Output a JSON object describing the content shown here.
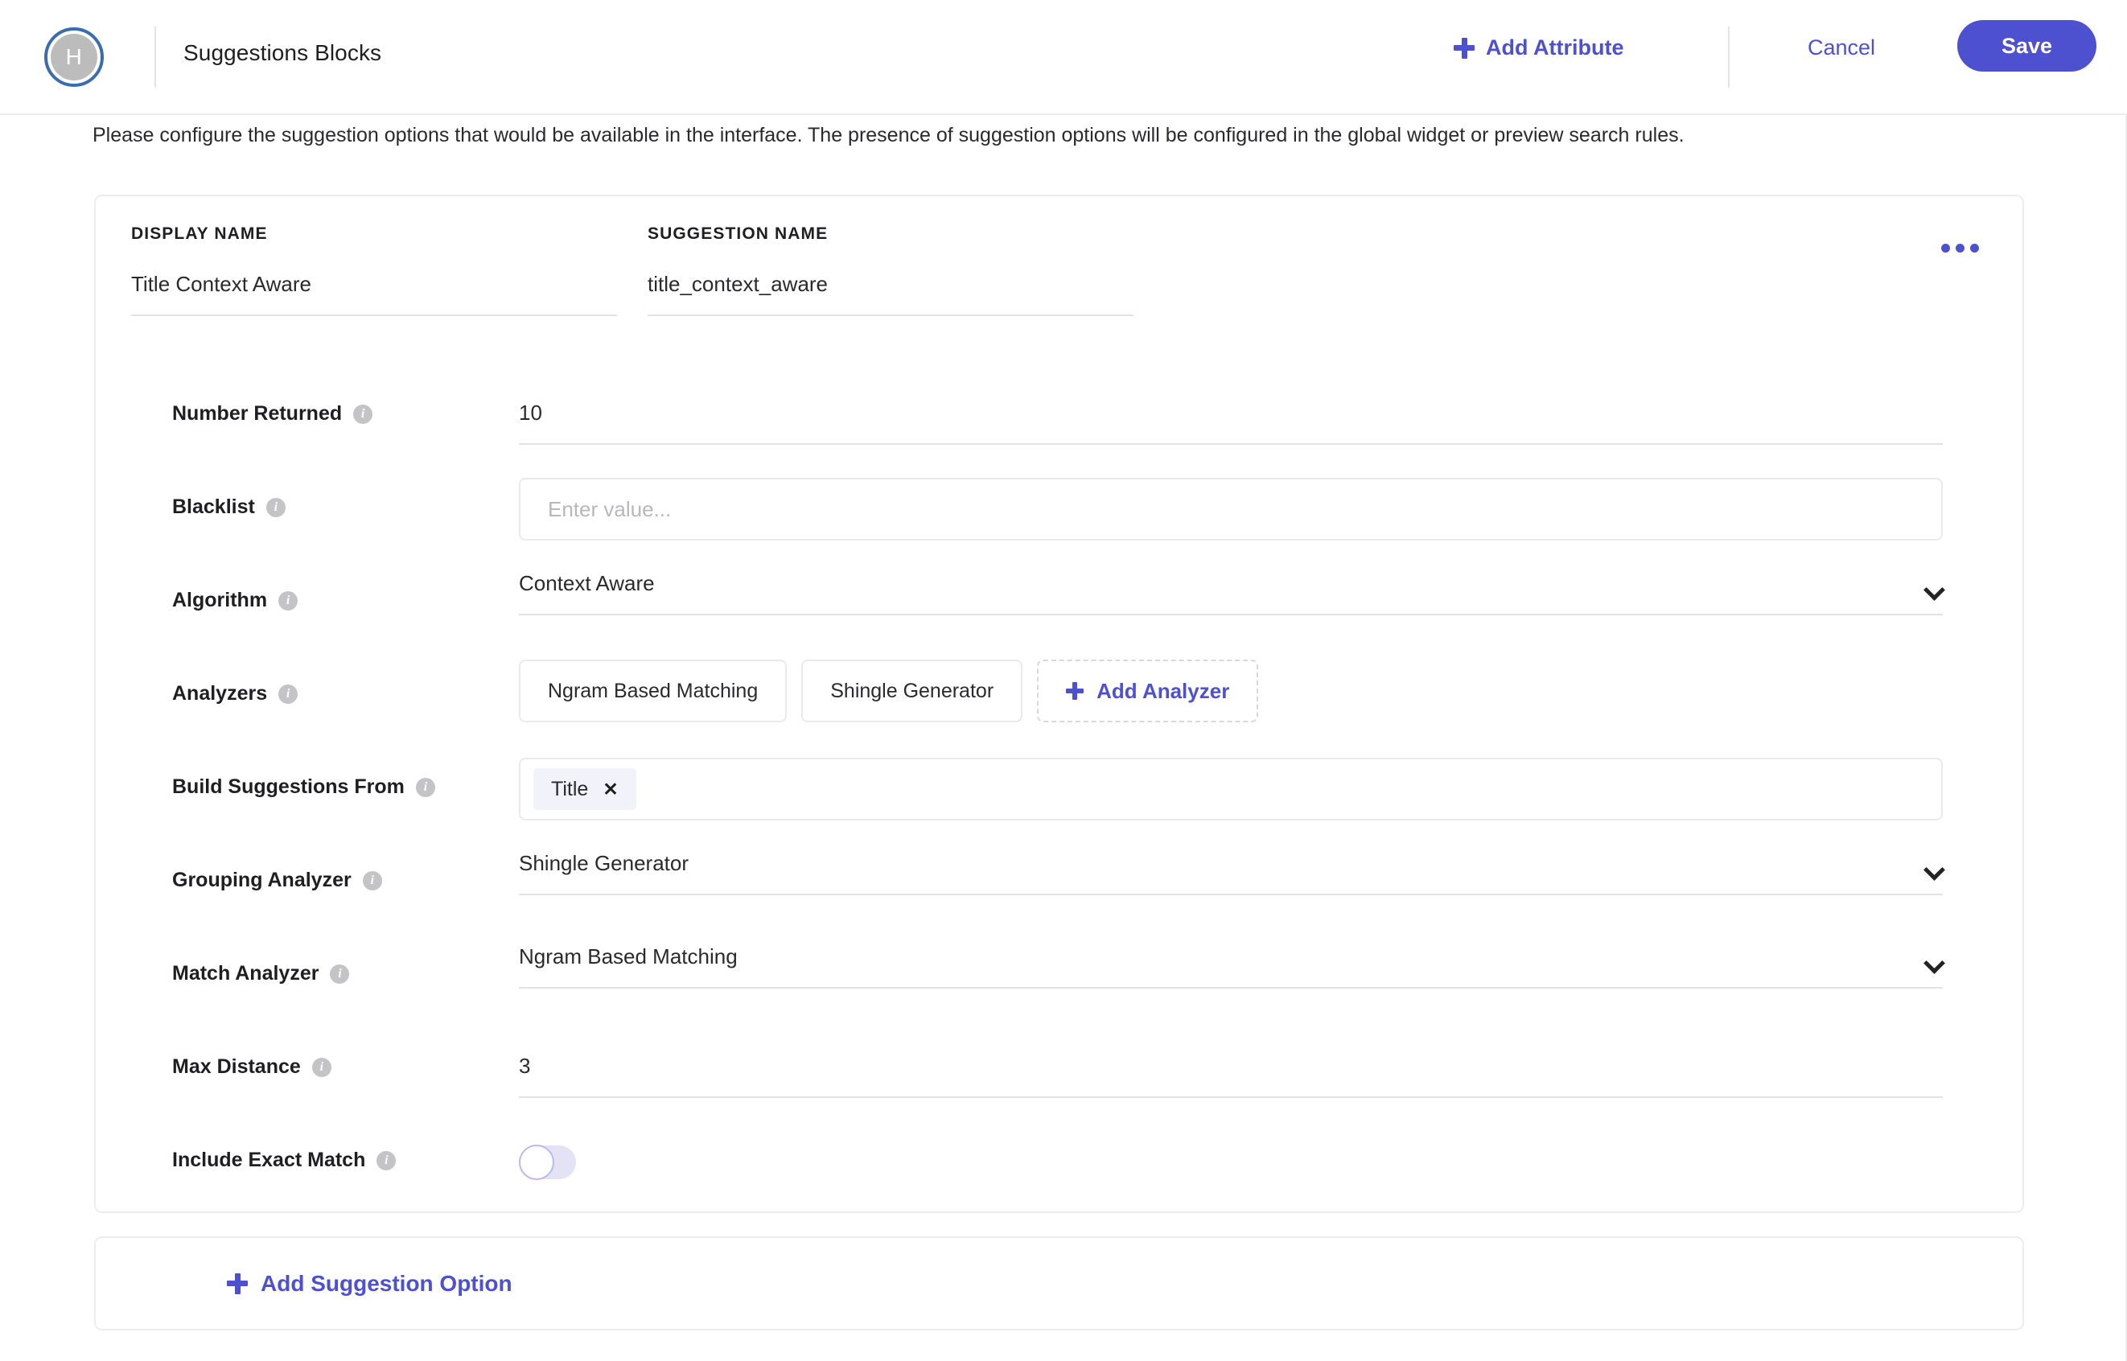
{
  "header": {
    "avatar_initial": "H",
    "title": "Suggestions Blocks",
    "add_attribute_label": "Add Attribute",
    "cancel_label": "Cancel",
    "save_label": "Save",
    "accent_color": "#4e51cf",
    "avatar_ring_color": "#3a6cb2"
  },
  "description": "Please configure the suggestion options that would be available in the interface. The presence of suggestion options will be configured in the global widget or preview search rules.",
  "card": {
    "display_name": {
      "label": "DISPLAY NAME",
      "value": "Title Context Aware"
    },
    "suggestion_name": {
      "label": "SUGGESTION NAME",
      "value": "title_context_aware"
    },
    "menu_icon": "ellipsis-icon",
    "fields": {
      "number_returned": {
        "label": "Number Returned",
        "value": "10"
      },
      "blacklist": {
        "label": "Blacklist",
        "value": "",
        "placeholder": "Enter value..."
      },
      "algorithm": {
        "label": "Algorithm",
        "value": "Context Aware"
      },
      "analyzers": {
        "label": "Analyzers",
        "chips": [
          "Ngram Based Matching",
          "Shingle Generator"
        ],
        "add_label": "Add Analyzer"
      },
      "build_suggestions_from": {
        "label": "Build Suggestions From",
        "tokens": [
          "Title"
        ],
        "remove_glyph": "✕"
      },
      "grouping_analyzer": {
        "label": "Grouping Analyzer",
        "value": "Shingle Generator"
      },
      "match_analyzer": {
        "label": "Match Analyzer",
        "value": "Ngram Based Matching"
      },
      "max_distance": {
        "label": "Max Distance",
        "value": "3"
      },
      "include_exact_match": {
        "label": "Include Exact Match",
        "enabled": false
      }
    }
  },
  "add_suggestion_option": {
    "label": "Add Suggestion Option"
  }
}
